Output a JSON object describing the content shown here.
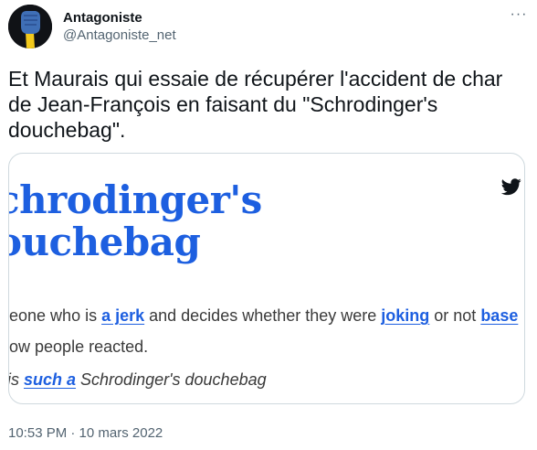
{
  "author": {
    "name": "Antagoniste",
    "handle": "@Antagoniste_net"
  },
  "tweet": {
    "text": "Et Maurais qui essaie de récupérer l'accident de char de Jean-François en faisant du \"Schrodinger's douchebag\".",
    "timestamp": "10:53 PM · 10 mars 2022"
  },
  "more_icon": "ellipsis-icon",
  "card": {
    "icon": "twitter-bird-icon",
    "word_line1": "chrodinger's",
    "word_line2": "ouchebag",
    "definition": {
      "pre": "neone who is ",
      "link1": "a jerk",
      "mid1": " and decides whether they were ",
      "link2": "joking",
      "mid2": " or not ",
      "link3": "base",
      "line2": "how people reacted."
    },
    "example": {
      "pre": "is ",
      "link": "such a",
      "post": " Schrodinger's douchebag"
    }
  },
  "colors": {
    "link_blue": "#1d5fe0",
    "secondary_text": "#536471",
    "border": "#cfd9de",
    "twitter_bird": "#0f1419"
  }
}
